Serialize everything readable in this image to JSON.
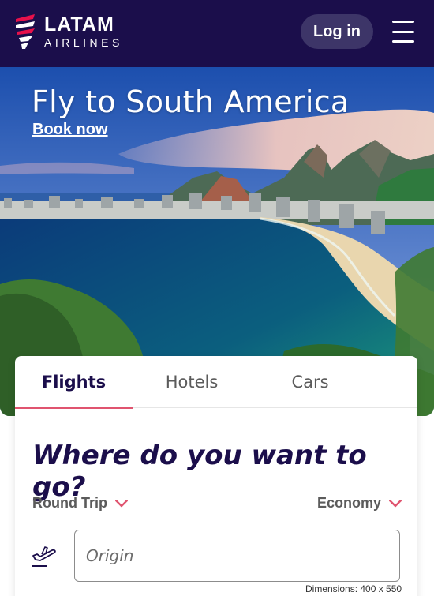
{
  "header": {
    "brand_name": "LATAM",
    "brand_sub": "AIRLINES",
    "login_label": "Log in",
    "menu_icon": "hamburger-menu-icon",
    "background": "#1b0e4b"
  },
  "hero": {
    "title": "Fly to South America",
    "cta": "Book now"
  },
  "search": {
    "tabs": [
      {
        "label": "Flights",
        "active": true
      },
      {
        "label": "Hotels",
        "active": false
      },
      {
        "label": "Cars",
        "active": false
      }
    ],
    "question": "Where do you want to go?",
    "trip_type": "Round Trip",
    "cabin_class": "Economy",
    "origin_placeholder": "Origin",
    "origin_icon": "plane-takeoff-icon"
  },
  "dimensions_label": "Dimensions: 400 x 550",
  "colors": {
    "brand_navy": "#1b0e4b",
    "accent_pink": "#e0546f",
    "login_bg": "#3d3568"
  }
}
